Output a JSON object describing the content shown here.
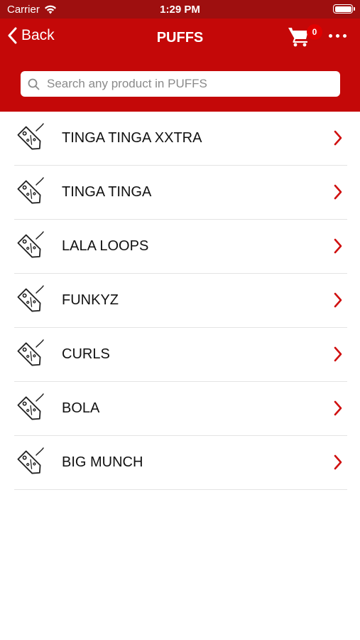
{
  "status": {
    "carrier": "Carrier",
    "time": "1:29 PM"
  },
  "nav": {
    "back_label": "Back",
    "title": "PUFFS",
    "cart_count": "0"
  },
  "search": {
    "placeholder": "Search any product in PUFFS"
  },
  "categories": [
    {
      "label": "TINGA TINGA XXTRA"
    },
    {
      "label": "TINGA TINGA"
    },
    {
      "label": "LALA LOOPS"
    },
    {
      "label": "FUNKYZ"
    },
    {
      "label": "CURLS"
    },
    {
      "label": "BOLA"
    },
    {
      "label": "BIG MUNCH"
    }
  ],
  "colors": {
    "status_bar": "#9e0f0f",
    "nav_bar": "#c40808",
    "chevron": "#d01010",
    "badge": "#e00000"
  },
  "icons": {
    "wifi": "wifi-icon",
    "battery": "battery-icon",
    "back": "chevron-left-icon",
    "cart": "cart-icon",
    "more": "more-dots-icon",
    "search": "search-icon",
    "tag": "discount-tag-icon",
    "chevron": "chevron-right-icon"
  }
}
